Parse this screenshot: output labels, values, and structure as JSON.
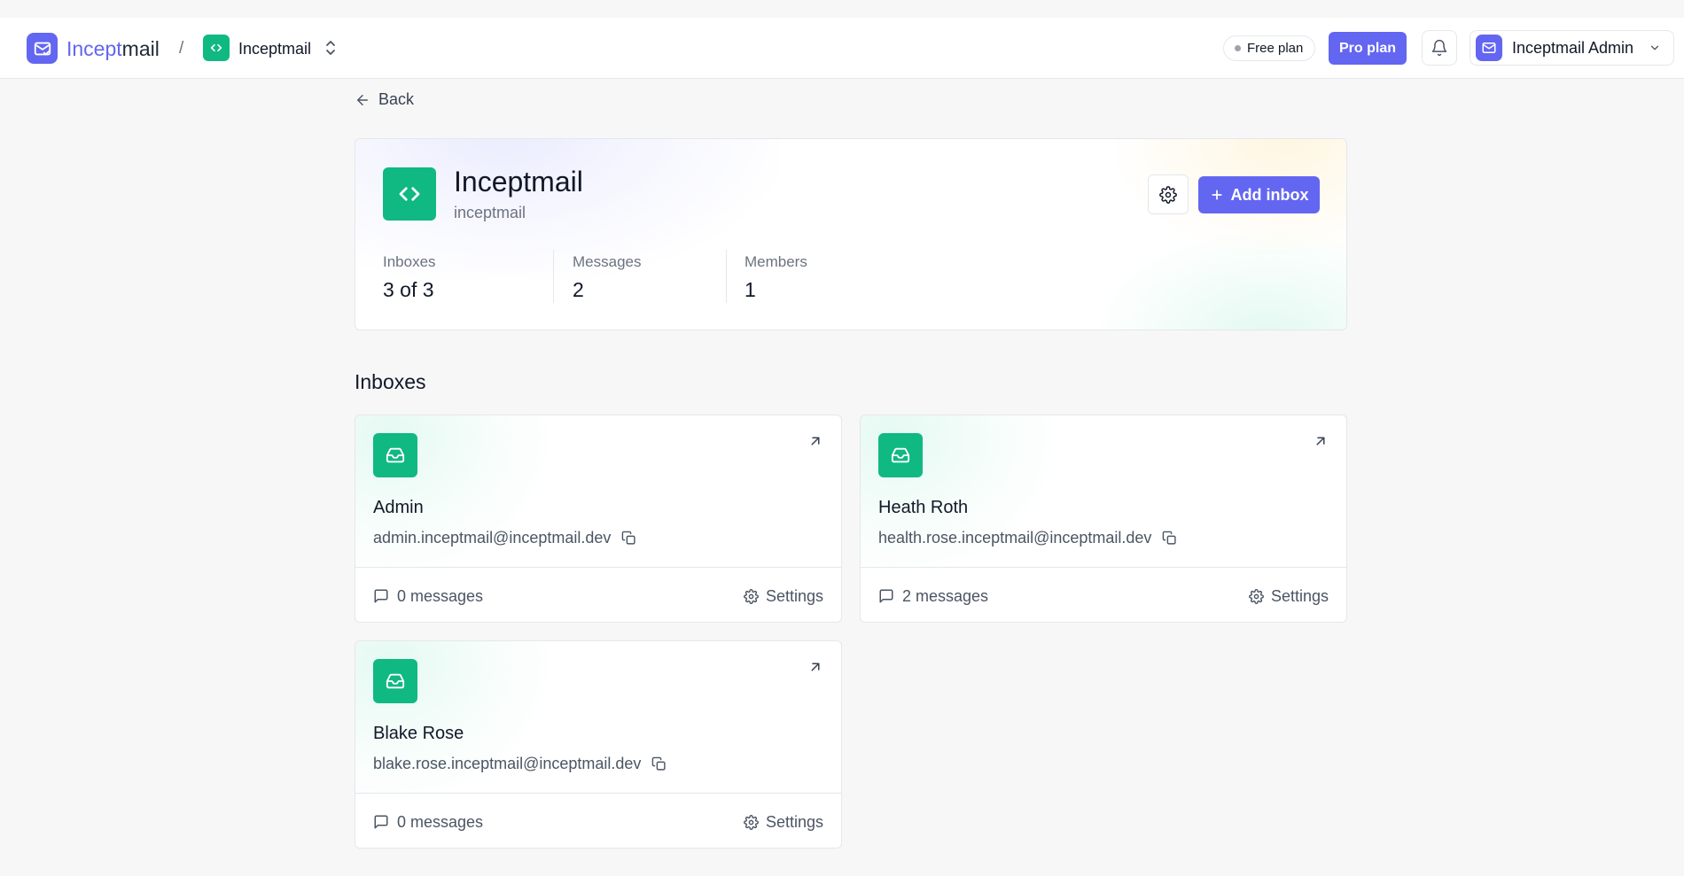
{
  "brand": {
    "name_part1": "Incept",
    "name_part2": "mail",
    "icon": "mail-icon"
  },
  "breadcrumb": {
    "separator": "/",
    "workspace_name": "Inceptmail",
    "workspace_icon": "code-icon"
  },
  "header": {
    "free_plan_label": "Free plan",
    "pro_plan_label": "Pro plan",
    "user_name": "Inceptmail Admin"
  },
  "back_label": "Back",
  "workspace": {
    "title": "Inceptmail",
    "slug": "inceptmail",
    "add_inbox_label": "Add inbox",
    "stats": [
      {
        "label": "Inboxes",
        "value": "3 of 3"
      },
      {
        "label": "Messages",
        "value": "2"
      },
      {
        "label": "Members",
        "value": "1"
      }
    ]
  },
  "inboxes_title": "Inboxes",
  "inboxes": [
    {
      "name": "Admin",
      "email": "admin.inceptmail@inceptmail.dev",
      "messages": "0 messages",
      "settings_label": "Settings"
    },
    {
      "name": "Heath Roth",
      "email": "health.rose.inceptmail@inceptmail.dev",
      "messages": "2 messages",
      "settings_label": "Settings"
    },
    {
      "name": "Blake Rose",
      "email": "blake.rose.inceptmail@inceptmail.dev",
      "messages": "0 messages",
      "settings_label": "Settings"
    }
  ],
  "colors": {
    "accent": "#6366f1",
    "green": "#10b981"
  }
}
